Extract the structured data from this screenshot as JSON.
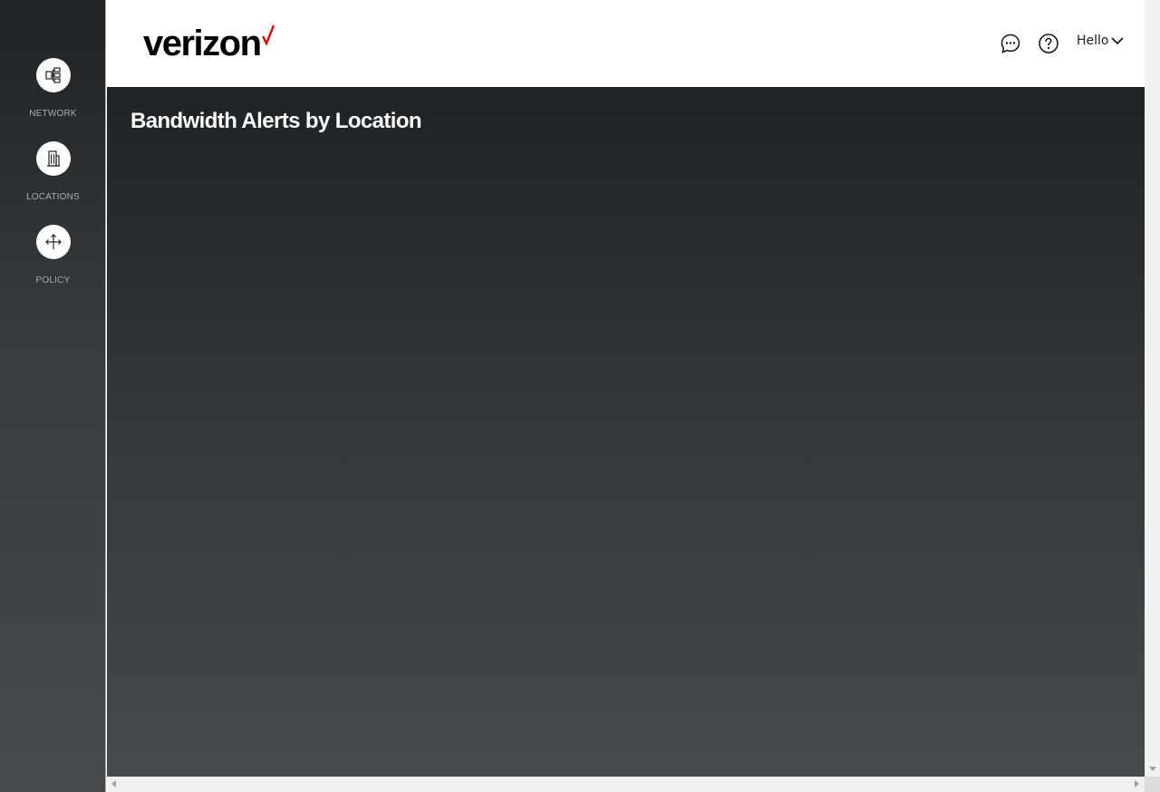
{
  "sidebar": {
    "items": [
      {
        "label": "NETWORK",
        "icon": "network-icon"
      },
      {
        "label": "LOCATIONS",
        "icon": "building-icon"
      },
      {
        "label": "POLICY",
        "icon": "move-arrows-icon"
      }
    ]
  },
  "header": {
    "logo_text": "verizon",
    "brand_check_color": "#ee0000",
    "chat_icon": "chat-bubble-icon",
    "help_icon": "help-circle-icon",
    "user_menu_label": "Hello",
    "user_menu_icon": "chevron-down-icon"
  },
  "main": {
    "title": "Bandwidth Alerts by Location"
  }
}
